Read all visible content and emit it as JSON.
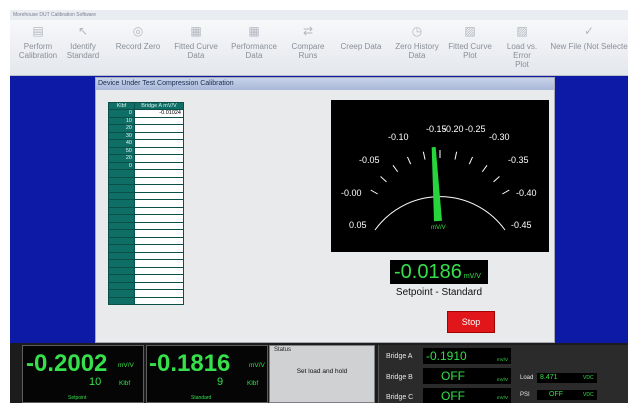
{
  "window": {
    "title": "Morehouse DUT Calibration Software"
  },
  "ribbon": [
    {
      "label": "Perform\nCalibration",
      "icon": "form-icon"
    },
    {
      "label": "Identify\nStandard",
      "icon": "pointer-icon"
    },
    {
      "label": "Record Zero",
      "icon": "circle-icon"
    },
    {
      "label": "Fitted Curve\nData",
      "icon": "grid-icon"
    },
    {
      "label": "Performance\nData",
      "icon": "grid-icon"
    },
    {
      "label": "Compare\nRuns",
      "icon": "compare-icon"
    },
    {
      "label": "Creep Data",
      "icon": "chart-icon"
    },
    {
      "label": "Zero History\nData",
      "icon": "history-icon"
    },
    {
      "label": "Fitted Curve\nPlot",
      "icon": "plot-icon"
    },
    {
      "label": "Load vs. Error\nPlot",
      "icon": "plot-icon"
    },
    {
      "label": "New File (Not Selecte",
      "icon": "check-icon"
    }
  ],
  "panel": {
    "title": "Device Under Test Compression Calibration"
  },
  "table": {
    "headers": [
      "Klbf",
      "Bridge A mV/V"
    ],
    "rows": [
      [
        "0",
        "-0.01024"
      ],
      [
        "10",
        ""
      ],
      [
        "20",
        ""
      ],
      [
        "30",
        ""
      ],
      [
        "40",
        ""
      ],
      [
        "50",
        ""
      ],
      [
        "20",
        ""
      ],
      [
        "0",
        ""
      ],
      [
        "",
        ""
      ],
      [
        "",
        ""
      ],
      [
        "",
        ""
      ],
      [
        "",
        ""
      ],
      [
        "",
        ""
      ],
      [
        "",
        ""
      ],
      [
        "",
        ""
      ],
      [
        "",
        ""
      ],
      [
        "",
        ""
      ],
      [
        "",
        ""
      ],
      [
        "",
        ""
      ],
      [
        "",
        ""
      ],
      [
        "",
        ""
      ],
      [
        "",
        ""
      ],
      [
        "",
        ""
      ],
      [
        "",
        ""
      ],
      [
        "",
        ""
      ],
      [
        "",
        ""
      ]
    ]
  },
  "gauge": {
    "ticks": [
      "0.05",
      "-0.00",
      "-0.05",
      "-0.10",
      "-0.15",
      "-0.20",
      "-0.25",
      "-0.30",
      "-0.35",
      "-0.40",
      "-0.45"
    ],
    "unit": "mV/V",
    "needle_value": -0.186
  },
  "digital": {
    "value": "-0.0186",
    "unit": "mV/V"
  },
  "setpoint_label": "Setpoint - Standard",
  "stop_label": "Stop",
  "setpoint_box": {
    "value": "-0.2002",
    "unit": "mV/V",
    "klbf": "10",
    "klbf_unit": "Klbf",
    "label": "Setpoint"
  },
  "standard_box": {
    "value": "-0.1816",
    "unit": "mV/V",
    "klbf": "9",
    "klbf_unit": "Klbf",
    "label": "Standard"
  },
  "status": {
    "title": "Status",
    "message": "Set load and hold"
  },
  "bridges": [
    {
      "label": "Bridge A",
      "value": "-0.1910",
      "unit": "mV/V"
    },
    {
      "label": "Bridge B",
      "value": "OFF",
      "unit": "mV/V"
    },
    {
      "label": "Bridge C",
      "value": "OFF",
      "unit": "mV/V"
    }
  ],
  "side": [
    {
      "label": "Load",
      "value": "8.471",
      "unit": "VDC"
    },
    {
      "label": "PSI",
      "value": "OFF",
      "unit": "VDC"
    }
  ]
}
